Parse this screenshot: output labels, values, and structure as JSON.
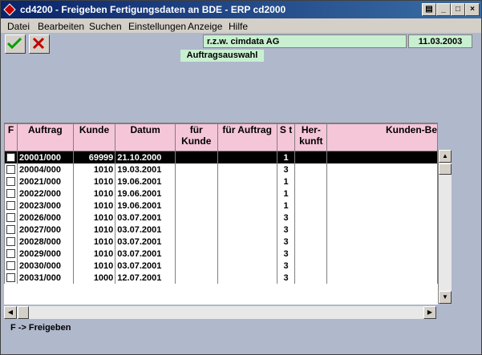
{
  "window": {
    "title": "cd4200 - Freigeben Fertigungsdaten an BDE - ERP cd2000"
  },
  "menu": [
    {
      "label": "Datei"
    },
    {
      "label": "Bearbeiten"
    },
    {
      "label": "Suchen"
    },
    {
      "label": "Einstellungen"
    },
    {
      "label": "Anzeige"
    },
    {
      "label": "Hilfe"
    }
  ],
  "header": {
    "company": "r.z.w. cimdata AG",
    "date": "11.03.2003",
    "section": "Auftragsauswahl"
  },
  "table": {
    "columns": [
      "F",
      "Auftrag",
      "Kunde",
      "Datum",
      "für Kunde",
      "für Auftrag",
      "S t",
      "Her-kunft",
      "Kunden-Be"
    ],
    "rows": [
      {
        "auftrag": "20001/000",
        "kunde": "69999",
        "datum": "21.10.2000",
        "st": "1",
        "selected": true
      },
      {
        "auftrag": "20004/000",
        "kunde": "1010",
        "datum": "19.03.2001",
        "st": "3"
      },
      {
        "auftrag": "20021/000",
        "kunde": "1010",
        "datum": "19.06.2001",
        "st": "1"
      },
      {
        "auftrag": "20022/000",
        "kunde": "1010",
        "datum": "19.06.2001",
        "st": "1"
      },
      {
        "auftrag": "20023/000",
        "kunde": "1010",
        "datum": "19.06.2001",
        "st": "1"
      },
      {
        "auftrag": "20026/000",
        "kunde": "1010",
        "datum": "03.07.2001",
        "st": "3"
      },
      {
        "auftrag": "20027/000",
        "kunde": "1010",
        "datum": "03.07.2001",
        "st": "3"
      },
      {
        "auftrag": "20028/000",
        "kunde": "1010",
        "datum": "03.07.2001",
        "st": "3"
      },
      {
        "auftrag": "20029/000",
        "kunde": "1010",
        "datum": "03.07.2001",
        "st": "3"
      },
      {
        "auftrag": "20030/000",
        "kunde": "1010",
        "datum": "03.07.2001",
        "st": "3"
      },
      {
        "auftrag": "20031/000",
        "kunde": "1000",
        "datum": "12.07.2001",
        "st": "3"
      }
    ]
  },
  "status": {
    "text": "F -> Freigeben"
  }
}
